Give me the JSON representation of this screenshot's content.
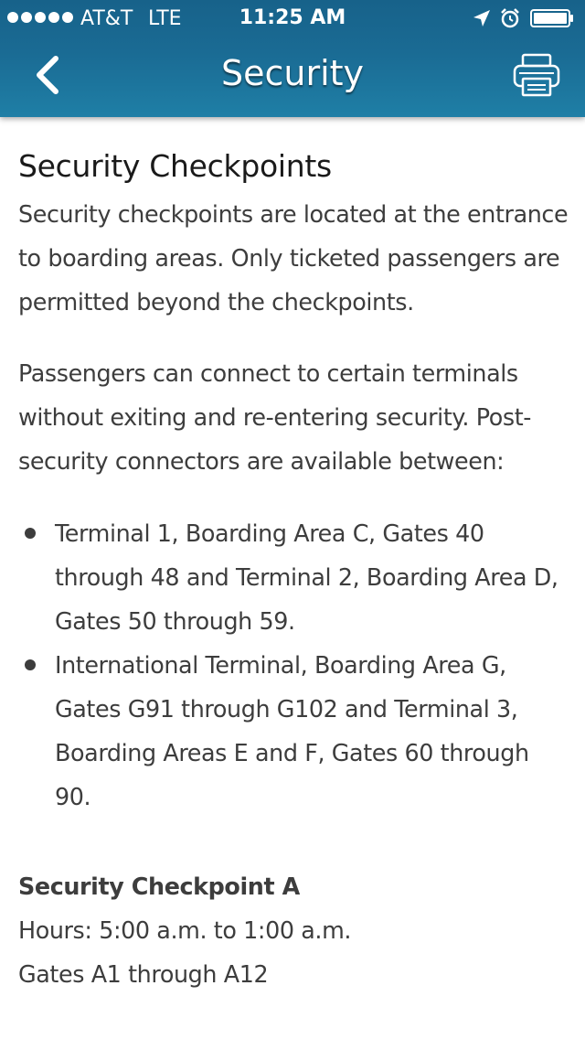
{
  "status_bar": {
    "signal_bars": 5,
    "carrier": "AT&T",
    "network": "LTE",
    "time": "11:25 AM",
    "icons": [
      "location-arrow-icon",
      "alarm-clock-icon",
      "battery-icon"
    ]
  },
  "nav": {
    "title": "Security",
    "back_icon": "chevron-left-icon",
    "print_icon": "printer-icon"
  },
  "content": {
    "heading": "Security Checkpoints",
    "paragraphs": [
      "Security checkpoints are located at the entrance to boarding areas. Only ticketed passengers are permitted beyond the checkpoints.",
      "Passengers can connect to certain terminals without exiting and re-entering security. Post-security connectors are available between:"
    ],
    "connectors": [
      "Terminal 1, Boarding Area C, Gates 40 through 48 and Terminal 2, Boarding Area D, Gates 50 through 59.",
      "International Terminal, Boarding Area G, Gates G91 through G102 and Terminal 3, Boarding Areas E and F, Gates 60 through 90."
    ],
    "checkpoint": {
      "title": "Security Checkpoint A",
      "hours": "Hours: 5:00 a.m. to 1:00 a.m.",
      "gates": "Gates A1 through A12"
    }
  },
  "colors": {
    "header_top": "#17628a",
    "header_bottom": "#1f7fa6",
    "text": "#3d3d3d",
    "heading_text": "#1a1a1a"
  }
}
